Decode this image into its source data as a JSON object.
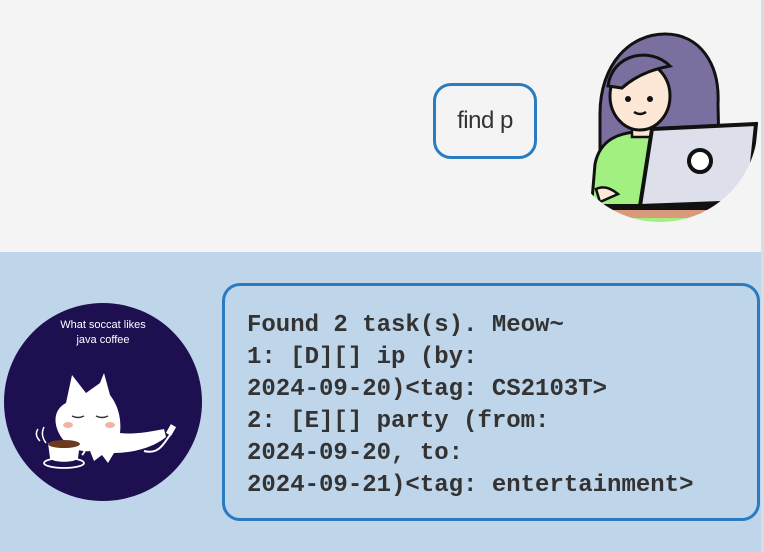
{
  "user_message": {
    "text": "find p"
  },
  "bot_message": {
    "text": "Found 2 task(s). Meow~\n1: [D][] ip (by:\n2024-09-20)<tag: CS2103T>\n2: [E][] party (from:\n2024-09-20, to:\n2024-09-21)<tag: entertainment>"
  },
  "bot_avatar": {
    "caption_line1": "What soccat likes",
    "caption_line2": "java coffee",
    "icon": "cat-drinking-coffee-icon",
    "background": "#1e0f50"
  },
  "user_avatar": {
    "icon": "girl-with-laptop-icon"
  },
  "colors": {
    "bubble_border": "#2a7bbf",
    "bot_row_bg": "#bed5ea",
    "user_row_bg": "#f4f4f4",
    "text": "#333333"
  }
}
